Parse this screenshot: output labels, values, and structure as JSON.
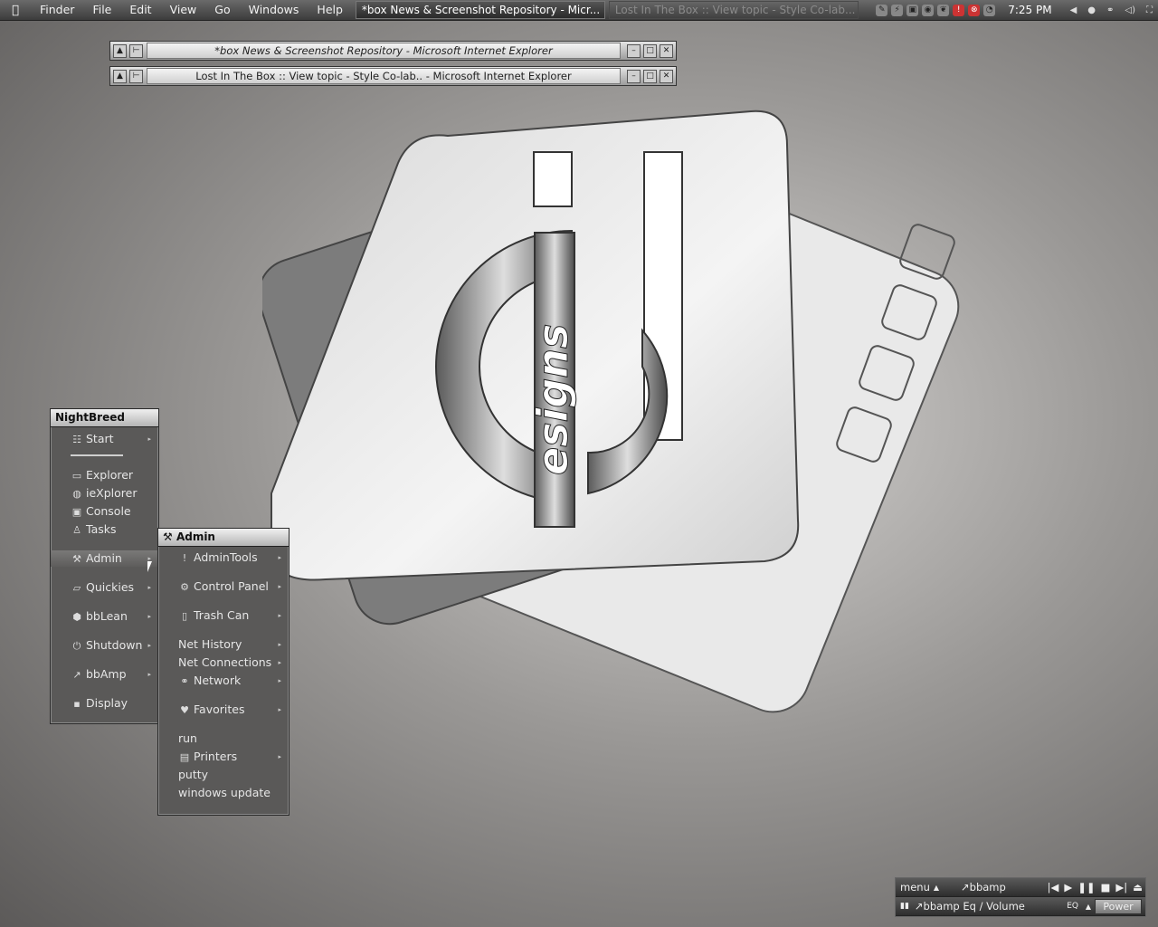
{
  "menubar": {
    "items": [
      "Finder",
      "File",
      "Edit",
      "View",
      "Go",
      "Windows",
      "Help"
    ],
    "tasks": [
      {
        "label": "*box News & Screenshot Repository - Micr...",
        "active": true
      },
      {
        "label": "Lost In The Box :: View topic - Style Co-lab...",
        "active": false
      }
    ],
    "clock": "7:25 PM"
  },
  "windows": [
    {
      "title": "*box News & Screenshot Repository - Microsoft Internet Explorer"
    },
    {
      "title": "Lost In The Box :: View topic - Style Co-lab.. - Microsoft Internet Explorer"
    }
  ],
  "logo": {
    "word": "esigns"
  },
  "main_menu": {
    "title": "NightBreed",
    "items": [
      {
        "label": "Start",
        "icon": "start-icon"
      },
      {
        "label": "Explorer",
        "icon": "folder-icon"
      },
      {
        "label": "ieXplorer",
        "icon": "globe-icon"
      },
      {
        "label": "Console",
        "icon": "console-icon"
      },
      {
        "label": "Tasks",
        "icon": "tasks-icon"
      },
      {
        "label": "Admin",
        "icon": "tools-icon"
      },
      {
        "label": "Quickies",
        "icon": "folder-open-icon"
      },
      {
        "label": "bbLean",
        "icon": "hexagon-icon"
      },
      {
        "label": "Shutdown",
        "icon": "power-icon"
      },
      {
        "label": "bbAmp",
        "icon": "bbamp-icon"
      },
      {
        "label": "Display",
        "icon": "monitor-icon"
      }
    ]
  },
  "admin_menu": {
    "title": "Admin",
    "items": [
      {
        "label": "AdminTools",
        "icon": "tool-icon"
      },
      {
        "label": "Control Panel",
        "icon": "control-panel-icon"
      },
      {
        "label": "Trash Can",
        "icon": "trash-icon"
      },
      {
        "label": "Net History",
        "icon": ""
      },
      {
        "label": "Net Connections",
        "icon": ""
      },
      {
        "label": "Network",
        "icon": "network-icon"
      },
      {
        "label": "Favorites",
        "icon": "heart-icon"
      },
      {
        "label": "run",
        "icon": ""
      },
      {
        "label": "Printers",
        "icon": "printer-icon"
      },
      {
        "label": "putty",
        "icon": ""
      },
      {
        "label": "windows update",
        "icon": ""
      }
    ]
  },
  "bbamp": {
    "menu_label": "menu",
    "title": "bbamp",
    "eq_label": "bbamp Eq / Volume",
    "power_label": "Power"
  }
}
